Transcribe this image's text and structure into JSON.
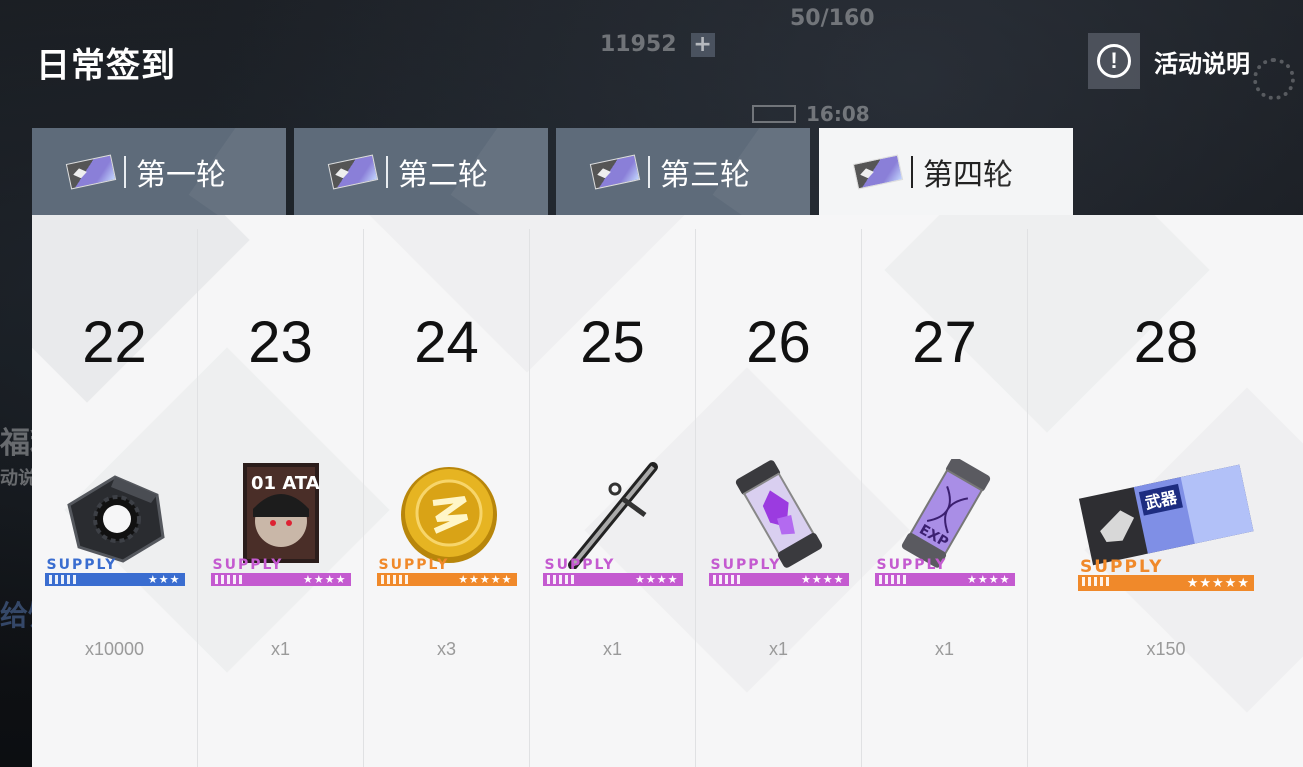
{
  "header": {
    "title": "日常签到",
    "info_label": "活动说明",
    "info_icon_glyph": "!"
  },
  "background": {
    "resource1_value": "11952",
    "resource2_value": "50/160",
    "time": "16:08",
    "left_text1": "福利",
    "left_text2": "动说",
    "left_text3": "给饭"
  },
  "tabs": [
    {
      "label": "第一轮",
      "active": false
    },
    {
      "label": "第二轮",
      "active": false
    },
    {
      "label": "第三轮",
      "active": false
    },
    {
      "label": "第四轮",
      "active": true
    }
  ],
  "days": [
    {
      "day": "22",
      "qty": "x10000",
      "supply": "SUPPLY",
      "stars": "★★★",
      "rarity": "blue",
      "icon": "hex-nut-icon"
    },
    {
      "day": "23",
      "qty": "x1",
      "supply": "SUPPLY",
      "stars": "★★★★",
      "rarity": "pink",
      "icon": "character-card-icon",
      "card_text": "01 ATA"
    },
    {
      "day": "24",
      "qty": "x3",
      "supply": "SUPPLY",
      "stars": "★★★★★",
      "rarity": "orange",
      "icon": "gold-coin-icon"
    },
    {
      "day": "25",
      "qty": "x1",
      "supply": "SUPPLY",
      "stars": "★★★★",
      "rarity": "pink",
      "icon": "weapon-rod-icon"
    },
    {
      "day": "26",
      "qty": "x1",
      "supply": "SUPPLY",
      "stars": "★★★★",
      "rarity": "pink",
      "icon": "crystal-canister-icon"
    },
    {
      "day": "27",
      "qty": "x1",
      "supply": "SUPPLY",
      "stars": "★★★★",
      "rarity": "pink",
      "icon": "exp-canister-icon",
      "canister_text": "EXP"
    },
    {
      "day": "28",
      "qty": "x150",
      "supply": "SUPPLY",
      "stars": "★★★★★",
      "rarity": "orange",
      "icon": "weapon-ticket-icon",
      "ticket_text": "武器"
    }
  ],
  "colors": {
    "blue": "#3a6dd0",
    "pink": "#c45ad0",
    "orange": "#f0892a",
    "tab_inactive": "#5e6b7a",
    "tab_active": "#f4f5f6"
  }
}
